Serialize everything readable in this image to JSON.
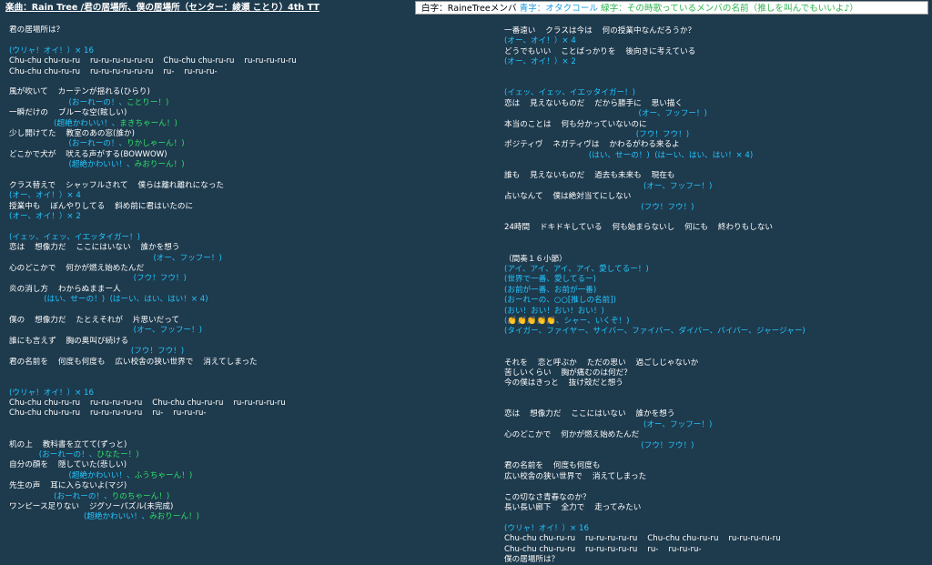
{
  "header_left": "楽曲：Rain Tree /君の居場所、僕の居場所（センター：綾瀬 ことり）4th TT",
  "header_right": {
    "white": "白字：RaineTreeメンバ",
    "blue": "青字：オタクコール",
    "green": "緑字：その時歌っているメンバの名前（推しを叫んでもいいよ♪）"
  },
  "left_lines": [
    {
      "c": "white",
      "t": "君の居場所は？"
    },
    {
      "c": "white",
      "t": ""
    },
    {
      "c": "blue",
      "t": "(ウリャ！オイ！）× 16"
    },
    {
      "c": "white",
      "t": "Chu-chu chu-ru-ru    ru-ru-ru-ru-ru-ru    Chu-chu chu-ru-ru    ru-ru-ru-ru-ru"
    },
    {
      "c": "white",
      "t": "Chu-chu chu-ru-ru    ru-ru-ru-ru-ru-ru    ru-    ru-ru-ru-"
    },
    {
      "c": "white",
      "t": ""
    },
    {
      "c": "white",
      "t": "風が吹いて    カーテンが揺れる(ひらり)"
    },
    {
      "c": "blue",
      "t": "                        (おーれーの！、",
      "g": "ことりー！)"
    },
    {
      "c": "white",
      "t": "一瞬だけの    ブルーな空(眩しい)"
    },
    {
      "c": "blue",
      "t": "                  (超絶かわいい！、",
      "g": "まきちゃーん！)"
    },
    {
      "c": "white",
      "t": "少し開けてた    教室のあの窓(誰か)"
    },
    {
      "c": "blue",
      "t": "                        (おーれーの！、",
      "g": "りかしゃーん！)"
    },
    {
      "c": "white",
      "t": "どこかで犬が    吠える声がする(BOWWOW)"
    },
    {
      "c": "blue",
      "t": "                        (超絶かわいい！、",
      "g": "みおりーん！)"
    },
    {
      "c": "white",
      "t": ""
    },
    {
      "c": "white",
      "t": "クラス替えで    シャッフルされて    僕らは離れ離れになった"
    },
    {
      "c": "blue",
      "t": "(オー、オイ！）× 4"
    },
    {
      "c": "white",
      "t": "授業中も    ぼんやりしてる    斜め前に君はいたのに"
    },
    {
      "c": "blue",
      "t": "(オー、オイ！）× 2"
    },
    {
      "c": "white",
      "t": ""
    },
    {
      "c": "blue",
      "t": "(イェッ、イェッ、イエッタイガー！)"
    },
    {
      "c": "white",
      "t": "恋は    想像力だ    ここにはいない    誰かを想う"
    },
    {
      "c": "blue",
      "t": "                                                          (オー、フッフー！)"
    },
    {
      "c": "white",
      "t": "心のどこかで    何かが燃え始めたんだ"
    },
    {
      "c": "blue",
      "t": "                                                  (フウ！フウ！)"
    },
    {
      "c": "white",
      "t": "炎の消し方    わからぬままー人"
    },
    {
      "c": "blue",
      "t": "              (はい、せーの！)  (はーい、はい、はい！× 4)"
    },
    {
      "c": "white",
      "t": ""
    },
    {
      "c": "white",
      "t": "僕の    想像力だ    たとえそれが    片思いだって"
    },
    {
      "c": "blue",
      "t": "                                                  (オー、フッフー！)"
    },
    {
      "c": "white",
      "t": "誰にも言えず    胸の奥叫び続ける"
    },
    {
      "c": "blue",
      "t": "                                                 (フウ！フウ！)"
    },
    {
      "c": "white",
      "t": "君の名前を    何度も何度も    広い校舎の狭い世界で    消えてしまった"
    },
    {
      "c": "white",
      "t": ""
    },
    {
      "c": "white",
      "t": ""
    },
    {
      "c": "blue",
      "t": "(ウリャ！オイ！）× 16"
    },
    {
      "c": "white",
      "t": "Chu-chu chu-ru-ru    ru-ru-ru-ru-ru    Chu-chu chu-ru-ru    ru-ru-ru-ru-ru"
    },
    {
      "c": "white",
      "t": "Chu-chu chu-ru-ru    ru-ru-ru-ru-ru    ru-    ru-ru-ru-"
    },
    {
      "c": "white",
      "t": ""
    },
    {
      "c": "white",
      "t": ""
    },
    {
      "c": "white",
      "t": "机の上    教科書を立てて(ずっと)"
    },
    {
      "c": "blue",
      "t": "            (おーれーの！、",
      "g": "ひなたー！)"
    },
    {
      "c": "white",
      "t": "自分の顔を    隠していた(悲しい)"
    },
    {
      "c": "blue",
      "t": "                        (超絶かわいい！、",
      "g": "ふうちゃーん！)"
    },
    {
      "c": "white",
      "t": "先生の声    耳に入らないよ(マジ)"
    },
    {
      "c": "blue",
      "t": "                  (おーれーの！、",
      "g": "りのちゃーん！)"
    },
    {
      "c": "white",
      "t": "ワンピース足りない    ジグソーパズル(未完成)"
    },
    {
      "c": "blue",
      "t": "                              (超絶かわいい！、",
      "g": "みおりーん！)"
    }
  ],
  "right_lines": [
    {
      "c": "white",
      "t": "一番遠い    クラスは今は    何の授業中なんだろうか？"
    },
    {
      "c": "blue",
      "t": "(オー、オイ！）× 4"
    },
    {
      "c": "white",
      "t": "どうでもいい    ことばっかりを    後向きに考えている"
    },
    {
      "c": "blue",
      "t": "(オー、オイ！）× 2"
    },
    {
      "c": "white",
      "t": ""
    },
    {
      "c": "white",
      "t": ""
    },
    {
      "c": "blue",
      "t": "(イェッ、イェッ、イエッタイガー！)"
    },
    {
      "c": "white",
      "t": "恋は    見えないものだ    だから勝手に    思い描く"
    },
    {
      "c": "blue",
      "t": "                                                      (オー、フッフー！)"
    },
    {
      "c": "white",
      "t": "本当のことは    何も分かっていないのに"
    },
    {
      "c": "blue",
      "t": "                                                     (フウ！フウ！)"
    },
    {
      "c": "white",
      "t": "ポジティヴ    ネガティヴは    かわるがわる来るよ"
    },
    {
      "c": "blue",
      "t": "                                  (はい、せーの！)  (はーい、はい、はい！× 4)"
    },
    {
      "c": "white",
      "t": ""
    },
    {
      "c": "white",
      "t": "誰も    見えないものだ    過去も未来も    現在も"
    },
    {
      "c": "blue",
      "t": "                                                        (オー、フッフー！)"
    },
    {
      "c": "white",
      "t": "占いなんて    僕は絶対当てにしない"
    },
    {
      "c": "blue",
      "t": "                                                       (フウ！フウ！)"
    },
    {
      "c": "white",
      "t": ""
    },
    {
      "c": "white",
      "t": "24時間    ドキドキしている    何も始まらないし    何にも    終わりもしない"
    },
    {
      "c": "white",
      "t": ""
    },
    {
      "c": "white",
      "t": ""
    },
    {
      "c": "white",
      "t": "（間奏１６小節）"
    },
    {
      "c": "blue",
      "t": "(アイ、アイ、アイ、アイ、愛してるー！)"
    },
    {
      "c": "blue",
      "t": "(世界で一番、愛してるー)"
    },
    {
      "c": "blue",
      "t": "(お前が一番、お前が一番)"
    },
    {
      "c": "blue",
      "t": "(おーれーの、○○[推しの名前])"
    },
    {
      "c": "blue",
      "t": "(おい！おい！おい！おい！)"
    },
    {
      "c": "blue",
      "t": "(👏👏👏👏👏、シャー、いくぞ！)"
    },
    {
      "c": "blue",
      "t": "(タイガー、ファイヤー、サイバー、ファイバー、ダイバー、バイバー、ジャージャー)"
    },
    {
      "c": "white",
      "t": ""
    },
    {
      "c": "white",
      "t": ""
    },
    {
      "c": "white",
      "t": "それを    恋と呼ぶか    ただの思い    過ごしじゃないか"
    },
    {
      "c": "white",
      "t": "苦しいくらい    胸が痛むのは何だ？"
    },
    {
      "c": "white",
      "t": "今の僕はきっと    抜け殻だと想う"
    },
    {
      "c": "white",
      "t": ""
    },
    {
      "c": "white",
      "t": ""
    },
    {
      "c": "white",
      "t": "恋は    想像力だ    ここにはいない    誰かを想う"
    },
    {
      "c": "blue",
      "t": "                                                        (オー、フッフー！)"
    },
    {
      "c": "white",
      "t": "心のどこかで    何かが燃え始めたんだ"
    },
    {
      "c": "blue",
      "t": "                                                       (フウ！フウ！)"
    },
    {
      "c": "white",
      "t": ""
    },
    {
      "c": "white",
      "t": "君の名前を    何度も何度も"
    },
    {
      "c": "white",
      "t": "広い校舎の狭い世界で    消えてしまった"
    },
    {
      "c": "white",
      "t": ""
    },
    {
      "c": "white",
      "t": "この切なさ青春なのか？"
    },
    {
      "c": "white",
      "t": "長い長い廊下    全力で    走ってみたい"
    },
    {
      "c": "white",
      "t": ""
    },
    {
      "c": "blue",
      "t": "(ウリャ！オイ！）× 16"
    },
    {
      "c": "white",
      "t": "Chu-chu chu-ru-ru    ru-ru-ru-ru-ru    Chu-chu chu-ru-ru    ru-ru-ru-ru-ru"
    },
    {
      "c": "white",
      "t": "Chu-chu chu-ru-ru    ru-ru-ru-ru-ru    ru-    ru-ru-ru-"
    },
    {
      "c": "white",
      "t": "僕の居場所は？"
    }
  ]
}
